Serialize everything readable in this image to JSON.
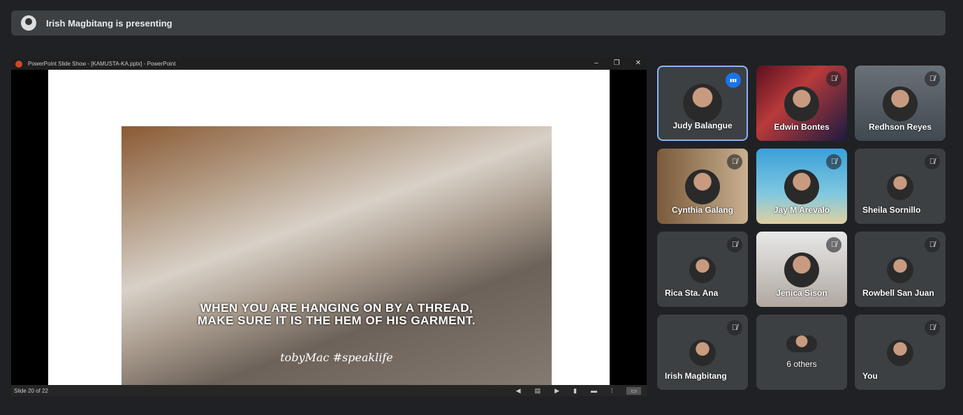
{
  "banner": {
    "text": "Irish Magbitang is presenting"
  },
  "window": {
    "title": "PowerPoint Slide Show - [KAMUSTA-KA.pptx] - PowerPoint",
    "minimize": "–",
    "restore": "❐",
    "close": "✕"
  },
  "slide": {
    "quote": "WHEN YOU ARE HANGING ON BY A THREAD, MAKE SURE IT IS THE HEM OF HIS GARMENT.",
    "signature": "tobyMac #speaklife"
  },
  "statusbar": {
    "slide_counter": "Slide 20 of 22",
    "icons": [
      "◀",
      "▤",
      "▶",
      "▮",
      "▬",
      "⁞",
      "▭"
    ]
  },
  "participants": [
    {
      "name": "Judy Balangue",
      "state": "speaking"
    },
    {
      "name": "Edwin Bontes",
      "state": "muted"
    },
    {
      "name": "Redhson Reyes",
      "state": "muted"
    },
    {
      "name": "Cynthia Galang",
      "state": "muted"
    },
    {
      "name": "Jay M Arevalo",
      "state": "muted"
    },
    {
      "name": "Sheila Sornillo",
      "state": "muted"
    },
    {
      "name": "Rica Sta. Ana",
      "state": "muted"
    },
    {
      "name": "Jenica Sison",
      "state": "muted"
    },
    {
      "name": "Rowbell San Juan",
      "state": "muted"
    },
    {
      "name": "Irish Magbitang",
      "state": "muted"
    },
    {
      "name": "6 others",
      "state": "group"
    },
    {
      "name": "You",
      "state": "muted"
    }
  ]
}
